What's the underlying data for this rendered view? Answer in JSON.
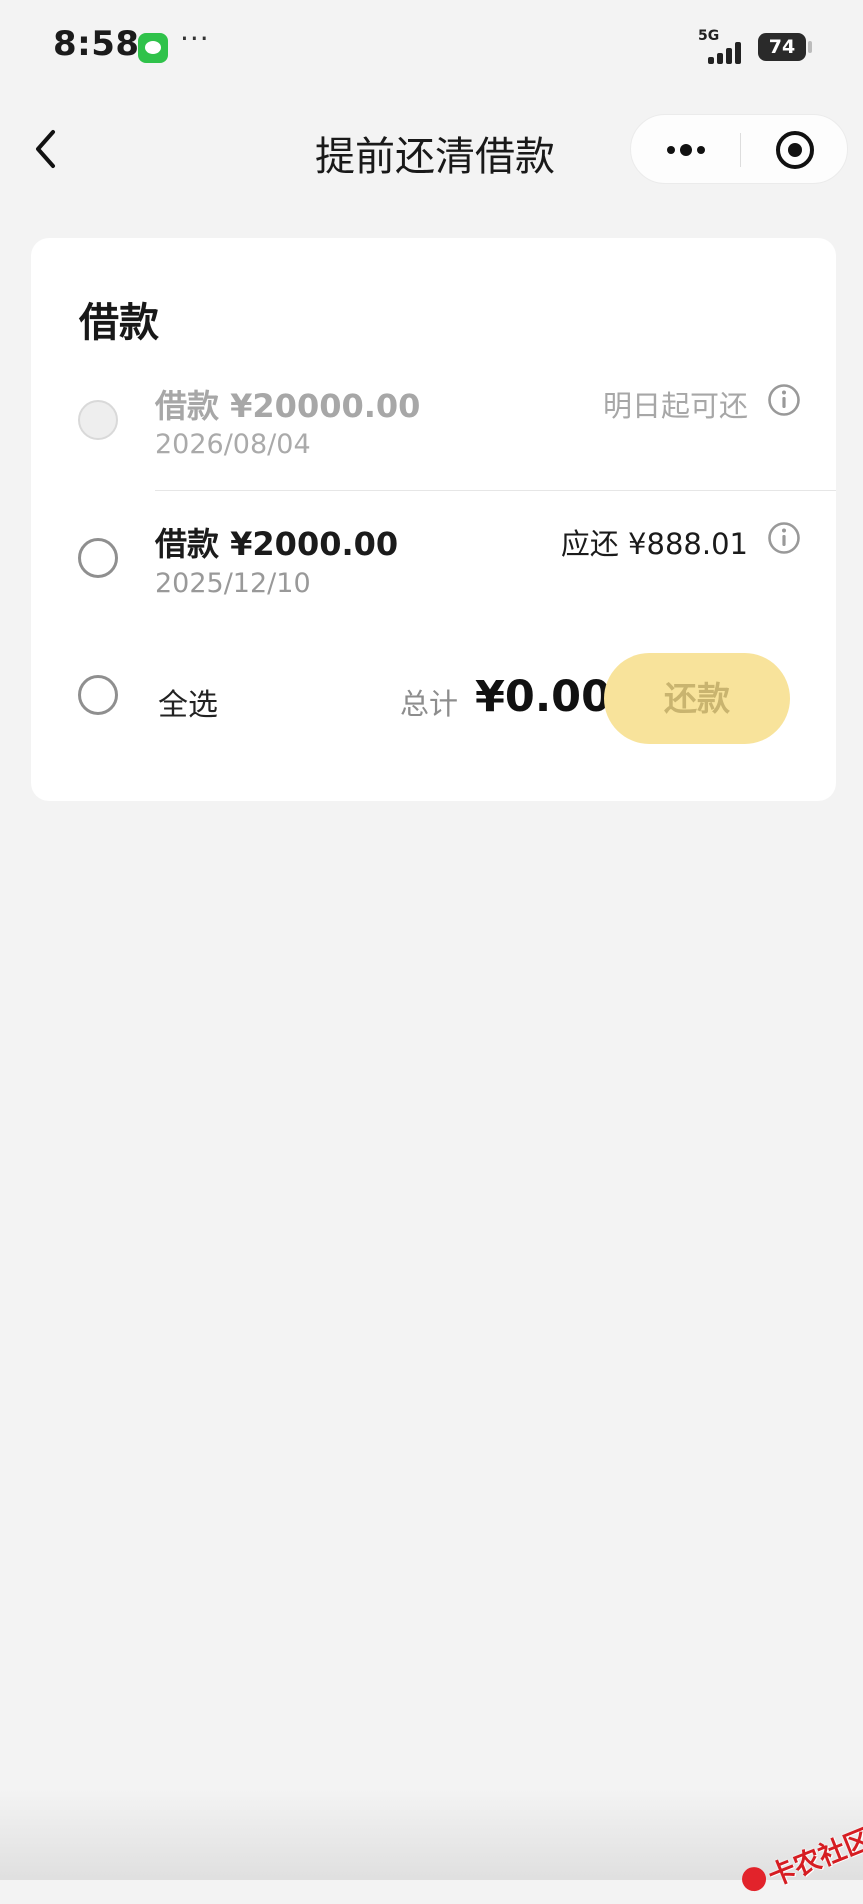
{
  "status_bar": {
    "time": "8:58",
    "more_indicator": "···",
    "network": "5G",
    "battery": "74"
  },
  "navbar": {
    "title": "提前还清借款",
    "icons": {
      "back": "chevron-left-icon",
      "more": "more-dots-icon",
      "close": "target-icon"
    }
  },
  "card": {
    "section_title": "借款",
    "loans": [
      {
        "title": "借款 ¥20000.00",
        "date": "2026/08/04",
        "status": "明日起可还",
        "enabled": false
      },
      {
        "title": "借款 ¥2000.00",
        "date": "2025/12/10",
        "status": "应还 ¥888.01",
        "enabled": true
      }
    ],
    "footer": {
      "select_all": "全选",
      "total_label": "总计",
      "total_amount": "¥0.00",
      "repay_button": "还款"
    }
  },
  "watermark": {
    "text": "卡农社区"
  },
  "colors": {
    "background": "#f3f3f3",
    "card": "#ffffff",
    "disabled_button": "#f8e39b",
    "disabled_button_text": "#c9b46f",
    "watermark_red": "#d61d22"
  }
}
